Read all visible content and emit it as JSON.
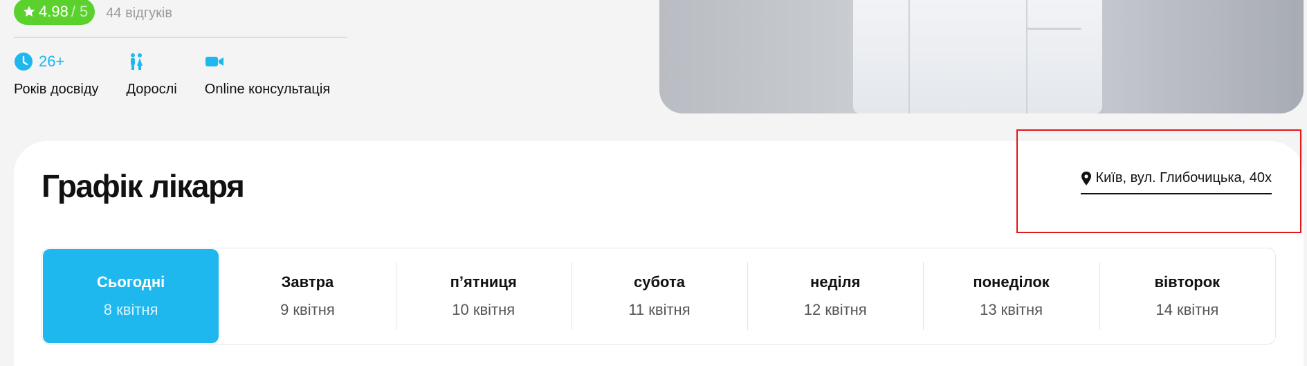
{
  "rating": {
    "score": "4.98",
    "max": "/ 5",
    "reviews": "44 відгуків"
  },
  "stats": [
    {
      "icon": "clock-icon",
      "value": "26+",
      "label": "Років досвіду"
    },
    {
      "icon": "adults-icon",
      "value": "",
      "label": "Дорослі"
    },
    {
      "icon": "video-camera-icon",
      "value": "",
      "label": "Online консультація"
    }
  ],
  "schedule": {
    "title": "Графік лікаря",
    "address": "Київ, вул. Глибочицька, 40х",
    "days": [
      {
        "name": "Сьогодні",
        "date": "8 квітня",
        "active": true
      },
      {
        "name": "Завтра",
        "date": "9 квітня",
        "active": false
      },
      {
        "name": "п’ятниця",
        "date": "10 квітня",
        "active": false
      },
      {
        "name": "субота",
        "date": "11 квітня",
        "active": false
      },
      {
        "name": "неділя",
        "date": "12 квітня",
        "active": false
      },
      {
        "name": "понеділок",
        "date": "13 квітня",
        "active": false
      },
      {
        "name": "вівторок",
        "date": "14 квітня",
        "active": false
      }
    ]
  },
  "colors": {
    "accent": "#1eb8ee",
    "rating": "#5bd12e",
    "highlight": "#e3161a"
  }
}
